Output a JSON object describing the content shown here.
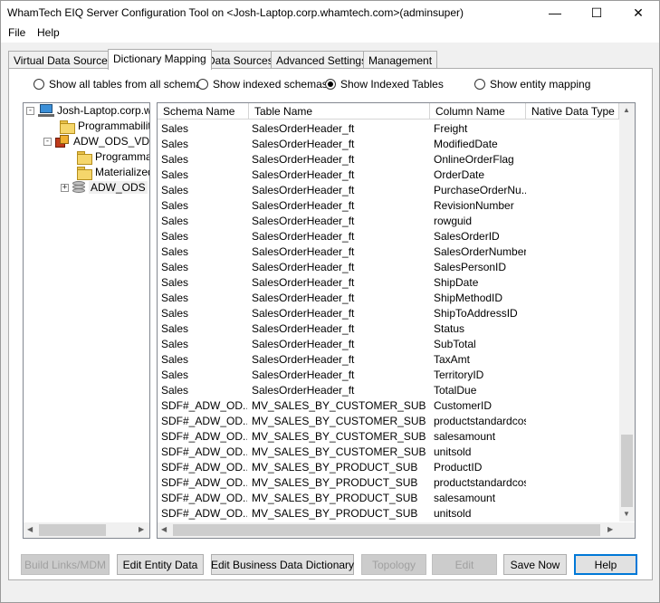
{
  "window": {
    "title": "WhamTech EIQ Server Configuration Tool on <Josh-Laptop.corp.whamtech.com>(adminsuper)",
    "controls": {
      "minimize": "—",
      "maximize": "☐",
      "close": "✕"
    }
  },
  "menu": {
    "items": [
      "File",
      "Help"
    ]
  },
  "tabs": [
    "Virtual Data Sources",
    "Dictionary Mapping",
    "Data Sources",
    "Advanced Settings",
    "Management"
  ],
  "active_tab": "Dictionary Mapping",
  "radios": {
    "options": [
      "Show all tables from all schemas",
      "Show indexed schemas",
      "Show Indexed Tables",
      "Show entity mapping"
    ],
    "selected": "Show Indexed Tables"
  },
  "tree": {
    "nodes": [
      {
        "label": "Josh-Laptop.corp.wh",
        "expander": "-"
      },
      {
        "label": "Programmability",
        "expander": ""
      },
      {
        "label": "ADW_ODS_VD",
        "expander": "-"
      },
      {
        "label": "Programmab",
        "expander": ""
      },
      {
        "label": "Materialized",
        "expander": ""
      },
      {
        "label": "ADW_ODS",
        "expander": "+"
      }
    ]
  },
  "grid": {
    "columns": [
      "Schema Name",
      "Table Name",
      "Column Name",
      "Native Data Type"
    ],
    "rows": [
      [
        "Sales",
        "SalesOrderHeader_ft",
        "Freight"
      ],
      [
        "Sales",
        "SalesOrderHeader_ft",
        "ModifiedDate"
      ],
      [
        "Sales",
        "SalesOrderHeader_ft",
        "OnlineOrderFlag"
      ],
      [
        "Sales",
        "SalesOrderHeader_ft",
        "OrderDate"
      ],
      [
        "Sales",
        "SalesOrderHeader_ft",
        "PurchaseOrderNu..."
      ],
      [
        "Sales",
        "SalesOrderHeader_ft",
        "RevisionNumber"
      ],
      [
        "Sales",
        "SalesOrderHeader_ft",
        "rowguid"
      ],
      [
        "Sales",
        "SalesOrderHeader_ft",
        "SalesOrderID"
      ],
      [
        "Sales",
        "SalesOrderHeader_ft",
        "SalesOrderNumber"
      ],
      [
        "Sales",
        "SalesOrderHeader_ft",
        "SalesPersonID"
      ],
      [
        "Sales",
        "SalesOrderHeader_ft",
        "ShipDate"
      ],
      [
        "Sales",
        "SalesOrderHeader_ft",
        "ShipMethodID"
      ],
      [
        "Sales",
        "SalesOrderHeader_ft",
        "ShipToAddressID"
      ],
      [
        "Sales",
        "SalesOrderHeader_ft",
        "Status"
      ],
      [
        "Sales",
        "SalesOrderHeader_ft",
        "SubTotal"
      ],
      [
        "Sales",
        "SalesOrderHeader_ft",
        "TaxAmt"
      ],
      [
        "Sales",
        "SalesOrderHeader_ft",
        "TerritoryID"
      ],
      [
        "Sales",
        "SalesOrderHeader_ft",
        "TotalDue"
      ],
      [
        "SDF#_ADW_OD...",
        "MV_SALES_BY_CUSTOMER_SUB",
        "CustomerID"
      ],
      [
        "SDF#_ADW_OD...",
        "MV_SALES_BY_CUSTOMER_SUB",
        "productstandardcost"
      ],
      [
        "SDF#_ADW_OD...",
        "MV_SALES_BY_CUSTOMER_SUB",
        "salesamount"
      ],
      [
        "SDF#_ADW_OD...",
        "MV_SALES_BY_CUSTOMER_SUB",
        "unitsold"
      ],
      [
        "SDF#_ADW_OD...",
        "MV_SALES_BY_PRODUCT_SUB",
        "ProductID"
      ],
      [
        "SDF#_ADW_OD...",
        "MV_SALES_BY_PRODUCT_SUB",
        "productstandardcost"
      ],
      [
        "SDF#_ADW_OD...",
        "MV_SALES_BY_PRODUCT_SUB",
        "salesamount"
      ],
      [
        "SDF#_ADW_OD...",
        "MV_SALES_BY_PRODUCT_SUB",
        "unitsold"
      ]
    ]
  },
  "buttons": [
    {
      "label": "Build Links/MDM",
      "disabled": true
    },
    {
      "label": "Edit Entity Data",
      "disabled": false
    },
    {
      "label": "Edit Business Data Dictionary",
      "disabled": false
    },
    {
      "label": "Topology",
      "disabled": true
    },
    {
      "label": "Edit",
      "disabled": true
    },
    {
      "label": "Save Now",
      "disabled": false
    },
    {
      "label": "Help",
      "disabled": false,
      "default": true
    }
  ],
  "colors": {
    "accent": "#0078d7",
    "disabled_text": "#a0a0a0",
    "folder": "#f5d66b"
  }
}
